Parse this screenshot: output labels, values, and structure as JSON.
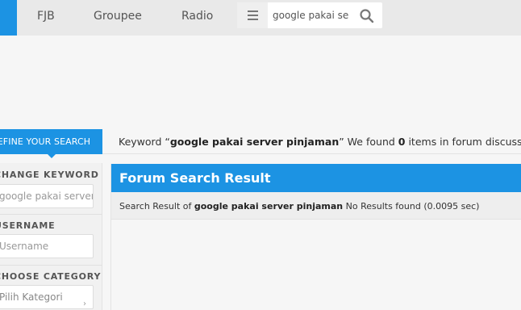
{
  "nav": {
    "items": [
      "FJB",
      "Groupee",
      "Radio"
    ],
    "search_value": "google pakai se"
  },
  "refine": {
    "tab_label": "REFINE YOUR SEARCH"
  },
  "keyword_bar": {
    "prefix": "Keyword “",
    "keyword": "google pakai server pinjaman",
    "middle": "” We found ",
    "count": "0",
    "suffix": " items in forum discussions"
  },
  "sidebar": {
    "change_keyword_title": "CHANGE KEYWORD",
    "change_keyword_value": "google pakai server p",
    "username_title": "USERNAME",
    "username_placeholder": "Username",
    "category_title": "CHOOSE CATEGORY",
    "category_value": "Pilih Kategori"
  },
  "result": {
    "title": "Forum Search Result",
    "sub_prefix": "Search Result of ",
    "sub_keyword": "google pakai server pinjaman",
    "sub_suffix": " No Results found (0.0095 sec)"
  },
  "colors": {
    "accent": "#1c93e3"
  }
}
